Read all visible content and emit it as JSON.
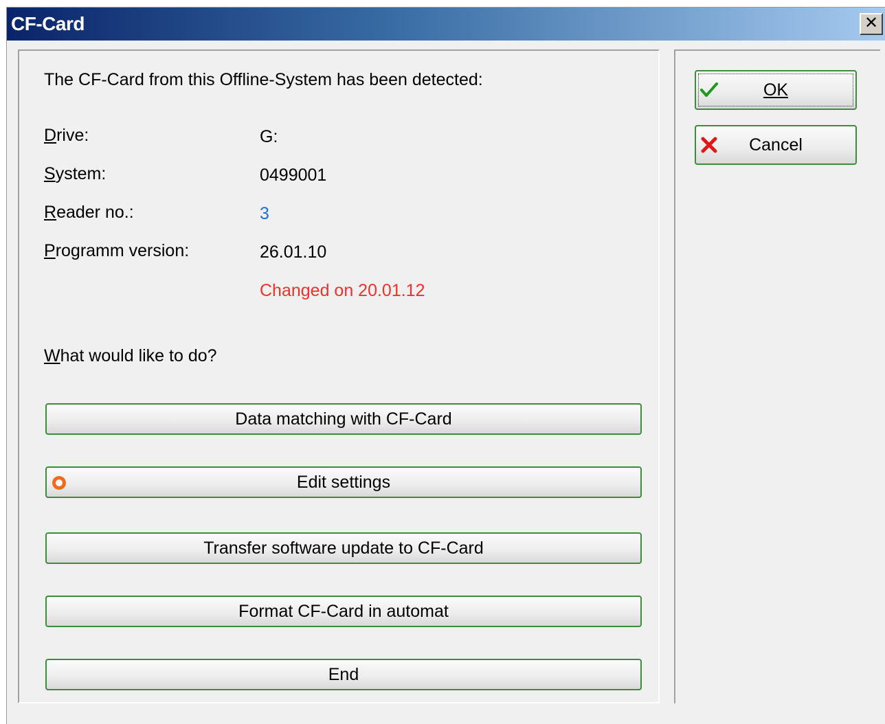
{
  "window": {
    "title": "CF-Card",
    "close_glyph": "✕"
  },
  "intro": "The CF-Card from this Offline-System has been detected:",
  "fields": [
    {
      "label": "Drive:",
      "value": "G:"
    },
    {
      "label": "System:",
      "value": "0499001"
    },
    {
      "label": "Reader no.:",
      "value": "3",
      "value_color": "#1f6fd6"
    },
    {
      "label": "Programm version:",
      "value": "26.01.10"
    }
  ],
  "changed_note": {
    "text": "Changed on 20.01.12",
    "color": "#f0302a"
  },
  "question": "What would like to do?",
  "actions": [
    {
      "label": "Data matching with CF-Card"
    },
    {
      "label": "Edit settings",
      "icon": "orange-radio-icon"
    },
    {
      "label": "Transfer software update to CF-Card"
    },
    {
      "label": "Format CF-Card in automat"
    },
    {
      "label": "End"
    }
  ],
  "side": {
    "ok": {
      "label": "OK",
      "icon": "green-check-icon"
    },
    "cancel": {
      "label": "Cancel",
      "icon": "red-x-icon"
    }
  },
  "colors": {
    "button_border": "#3c8c3c",
    "title_start": "#0a246a",
    "title_end": "#a6caf0"
  }
}
